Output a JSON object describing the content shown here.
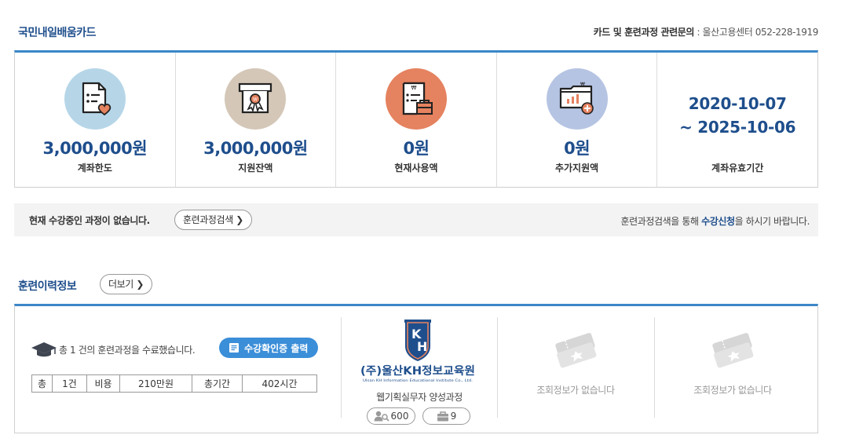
{
  "card_section": {
    "title": "국민내일배움카드",
    "contact_label": "카드 및 훈련과정 관련문의",
    "contact_sep": " : ",
    "contact_value": "울산고용센터 052-228-1919",
    "items": [
      {
        "icon": "document-heart-icon",
        "amount": "3,000,000원",
        "label": "계좌한도",
        "bg": "#b6d6e8"
      },
      {
        "icon": "certificate-box-icon",
        "amount": "3,000,000원",
        "label": "지원잔액",
        "bg": "#d4c7b8"
      },
      {
        "icon": "receipt-wallet-icon",
        "amount": "0원",
        "label": "현재사용액",
        "bg": "#e5825f"
      },
      {
        "icon": "folder-chart-plus-icon",
        "amount": "0원",
        "label": "추가지원액",
        "bg": "#b6c4e3"
      }
    ],
    "period": {
      "line1": "2020-10-07",
      "line2": "~ 2025-10-06",
      "label": "계좌유효기간"
    }
  },
  "status_bar": {
    "text": "현재 수강중인 과정이 없습니다.",
    "search_button": "훈련과정검색",
    "hint_before": "훈련과정검색을 통해 ",
    "hint_bold": "수강신청",
    "hint_after": "을 하시기 바랍니다."
  },
  "history_section": {
    "title": "훈련이력정보",
    "more_button": "더보기",
    "summary": "총 1 건의 훈련과정을 수료했습니다.",
    "cert_button": "수강확인증 출력",
    "table": {
      "cells": [
        "총",
        "1건",
        "비용",
        "210만원",
        "총기간",
        "402시간"
      ]
    },
    "course": {
      "logo_main": "(주)울산KH정보교육원",
      "logo_sub": "Ulsan KH Information Educational Institute Co., Ltd.",
      "name": "웹기획실무자 양성과정",
      "views": "600",
      "count": "9"
    },
    "empty_slots": [
      "조회정보가 없습니다",
      "조회정보가 없습니다"
    ]
  },
  "colors": {
    "accent": "#1e4e8c",
    "line": "#3b87c8",
    "button": "#3b8ed8"
  }
}
